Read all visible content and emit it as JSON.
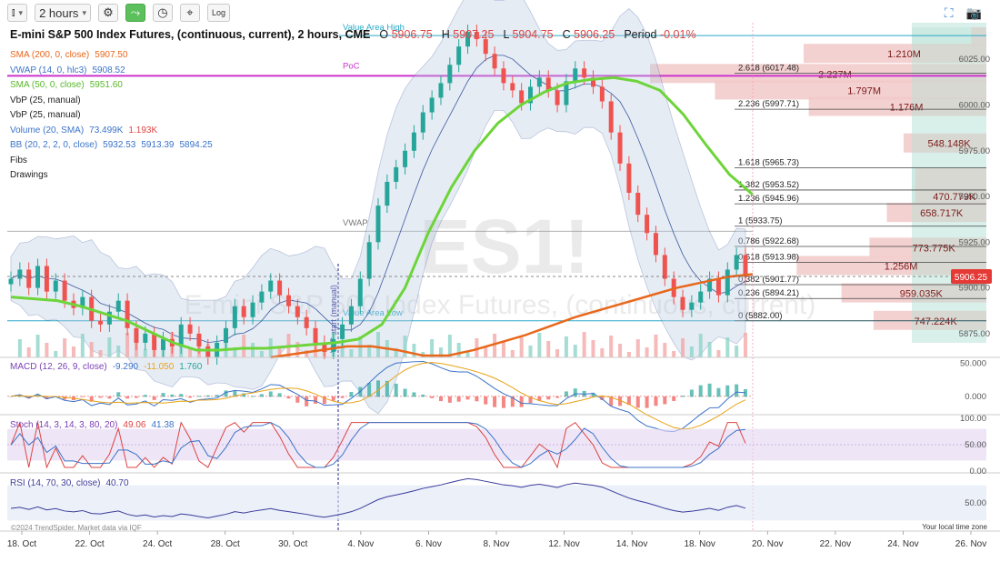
{
  "toolbar": {
    "bars_icon": "candles-icon",
    "interval_label": "2 hours",
    "settings_icon": "gear-icon",
    "draw_icon": "line-chart-icon",
    "clock_icon": "clock-icon",
    "cross_icon": "crosshair-icon",
    "log_label": "Log",
    "fullscreen_icon": "fullscreen-icon",
    "camera_icon": "camera-icon"
  },
  "header": {
    "title": "E-mini S&P 500 Index Futures, (continuous, current), 2 hours, CME",
    "o_label": "O",
    "o_val": "5906.75",
    "h_label": "H",
    "h_val": "5907.25",
    "l_label": "L",
    "l_val": "5904.75",
    "c_label": "C",
    "c_val": "5906.25",
    "period_label": "Period",
    "period_val": "-0.01%"
  },
  "legend": [
    {
      "name": "SMA (200, 0, close)",
      "values": [
        "5907.50"
      ],
      "color": "#e8671b"
    },
    {
      "name": "VWAP (14, 0, hlc3)",
      "values": [
        "5908.52"
      ],
      "color": "#3b73c9"
    },
    {
      "name": "SMA (50, 0, close)",
      "values": [
        "5951.60"
      ],
      "color": "#6dd43a"
    },
    {
      "name": "VbP (25, manual)",
      "values": [],
      "color": "#333333"
    },
    {
      "name": "VbP (25, manual)",
      "values": [],
      "color": "#333333"
    },
    {
      "name": "Volume (20, SMA)",
      "values": [
        "73.499K",
        "1.193K"
      ],
      "color": "#3b73c9"
    },
    {
      "name": "BB (20, 2, 2, 0, close)",
      "values": [
        "5932.53",
        "5913.39",
        "5894.25"
      ],
      "color": "#3b73c9"
    },
    {
      "name": "Fibs",
      "values": [],
      "color": "#333333"
    },
    {
      "name": "Drawings",
      "values": [],
      "color": "#333333"
    }
  ],
  "macd_legend": {
    "name": "MACD (12, 26, 9, close)",
    "values": [
      "-9.290",
      "-11.050",
      "1.760"
    ]
  },
  "stoch_legend": {
    "name": "Stoch (14, 3, 14, 3, 80, 20)",
    "values": [
      "49.06",
      "41.38"
    ]
  },
  "rsi_legend": {
    "name": "RSI (14, 70, 30, close)",
    "values": [
      "40.70"
    ]
  },
  "watermark": {
    "symbol": "ES1!",
    "name": "E-mini S&P 500 Index Futures, (continuous, current)"
  },
  "annotations": {
    "value_area_high": "Value Area High",
    "poc": "PoC",
    "vwap": "VWAP",
    "value_area_low": "Value Area Low",
    "vbp_start": "VbP start (manual)"
  },
  "price_axis": {
    "ticks": [
      "6025.00",
      "6000.00",
      "5975.00",
      "5950.00",
      "5925.00",
      "5900.00",
      "5875.00"
    ],
    "current": "5906.25"
  },
  "macd_axis": [
    "50.000",
    "0.000"
  ],
  "stoch_axis": [
    "100.00",
    "50.00",
    "0.00"
  ],
  "rsi_axis": [
    "50.00"
  ],
  "x_axis": {
    "labels": [
      "18. Oct",
      "22. Oct",
      "24. Oct",
      "28. Oct",
      "30. Oct",
      "4. Nov",
      "6. Nov",
      "8. Nov",
      "12. Nov",
      "14. Nov",
      "18. Nov",
      "20. Nov",
      "22. Nov",
      "24. Nov",
      "26. Nov"
    ]
  },
  "copyright": "©2024 TrendSpider. Market data via IQF",
  "timezone": "Your local time zone",
  "colors": {
    "up": "#26a69a",
    "down": "#ef5350",
    "sma50": "#6dd43a",
    "sma200": "#e8671b",
    "bb": "#3b5aa0",
    "vap": "#d9f0ea",
    "poc": "#cc33cc",
    "value_area": "#2aa8c8"
  },
  "chart_data": {
    "type": "candlestick",
    "price_range": [
      5862,
      6045
    ],
    "fib_levels": [
      {
        "label": "2.618 (6017.48)",
        "value": 6017.48
      },
      {
        "label": "2.236 (5997.71)",
        "value": 5997.71
      },
      {
        "label": "1.618 (5965.73)",
        "value": 5965.73
      },
      {
        "label": "1.382 (5953.52)",
        "value": 5953.52
      },
      {
        "label": "1.236 (5945.96)",
        "value": 5945.96
      },
      {
        "label": "1 (5933.75)",
        "value": 5933.75
      },
      {
        "label": "0.786 (5922.68)",
        "value": 5922.68
      },
      {
        "label": "0.618 (5913.98)",
        "value": 5913.98
      },
      {
        "label": "0.382 (5901.77)",
        "value": 5901.77
      },
      {
        "label": "0.236 (5894.21)",
        "value": 5894.21
      },
      {
        "label": "0 (5882.00)",
        "value": 5882.0
      }
    ],
    "volume_profile": [
      {
        "price": 6037,
        "volume": 0.1,
        "label": ""
      },
      {
        "price": 6028,
        "volume": 1.21,
        "label": "1.210M"
      },
      {
        "price": 6017,
        "volume": 2.227,
        "label": "2.227M"
      },
      {
        "price": 6008,
        "volume": 1.797,
        "label": "1.797M"
      },
      {
        "price": 5999,
        "volume": 1.176,
        "label": "1.176M"
      },
      {
        "price": 5979,
        "volume": 0.548,
        "label": "548.148K"
      },
      {
        "price": 5960,
        "volume": 0.47,
        "label": ""
      },
      {
        "price": 5950,
        "volume": 0.471,
        "label": "470.779K"
      },
      {
        "price": 5941,
        "volume": 0.659,
        "label": "658.717K"
      },
      {
        "price": 5922,
        "volume": 0.774,
        "label": "773.775K"
      },
      {
        "price": 5912,
        "volume": 1.256,
        "label": "1.256M"
      },
      {
        "price": 5897,
        "volume": 0.959,
        "label": "959.035K"
      },
      {
        "price": 5882,
        "volume": 0.747,
        "label": "747.224K"
      }
    ],
    "value_area_high": 6038,
    "value_area_low": 5882,
    "poc": 6016,
    "vwap_anchor": 5931,
    "closes": [
      5905,
      5910,
      5900,
      5912,
      5898,
      5904,
      5893,
      5889,
      5895,
      5882,
      5880,
      5887,
      5893,
      5878,
      5870,
      5875,
      5866,
      5872,
      5868,
      5880,
      5875,
      5868,
      5862,
      5870,
      5878,
      5890,
      5884,
      5892,
      5898,
      5904,
      5896,
      5890,
      5884,
      5878,
      5870,
      5865,
      5872,
      5880,
      5890,
      5905,
      5925,
      5945,
      5958,
      5966,
      5975,
      5985,
      5996,
      6004,
      6012,
      6022,
      6032,
      6040,
      6036,
      6028,
      6020,
      6012,
      6008,
      6001,
      6010,
      6015,
      6008,
      6000,
      6013,
      6020,
      6015,
      6010,
      6002,
      5985,
      5968,
      5952,
      5940,
      5930,
      5918,
      5905,
      5895,
      5888,
      5892,
      5898,
      5905,
      5896,
      5910,
      5918,
      5906
    ],
    "sma50": [
      5895,
      5894,
      5893,
      5890,
      5886,
      5882,
      5876,
      5870,
      5866,
      5866,
      5867,
      5867,
      5868,
      5869,
      5870,
      5872,
      5880,
      5900,
      5930,
      5955,
      5975,
      5990,
      6000,
      6007,
      6012,
      6014,
      6015,
      6013,
      6008,
      5995,
      5978,
      5962,
      5951
    ],
    "sma200": [
      5862,
      5864,
      5866,
      5868,
      5868,
      5866,
      5863,
      5863,
      5866,
      5870,
      5874,
      5879,
      5884,
      5888,
      5892,
      5896,
      5900,
      5903,
      5906,
      5907.5
    ],
    "vwap": 5908.52,
    "bollinger": {
      "upper": 5932.53,
      "middle": 5913.39,
      "lower": 5894.25
    },
    "macd": {
      "macd": -9.29,
      "signal": -11.05,
      "hist": 1.76,
      "range": [
        -25,
        55
      ]
    },
    "stoch": {
      "k": 49.06,
      "d": 41.38,
      "upper": 80,
      "lower": 20,
      "range": [
        0,
        100
      ]
    },
    "rsi": {
      "value": 40.7,
      "upper": 70,
      "lower": 30,
      "range": [
        20,
        80
      ]
    }
  }
}
